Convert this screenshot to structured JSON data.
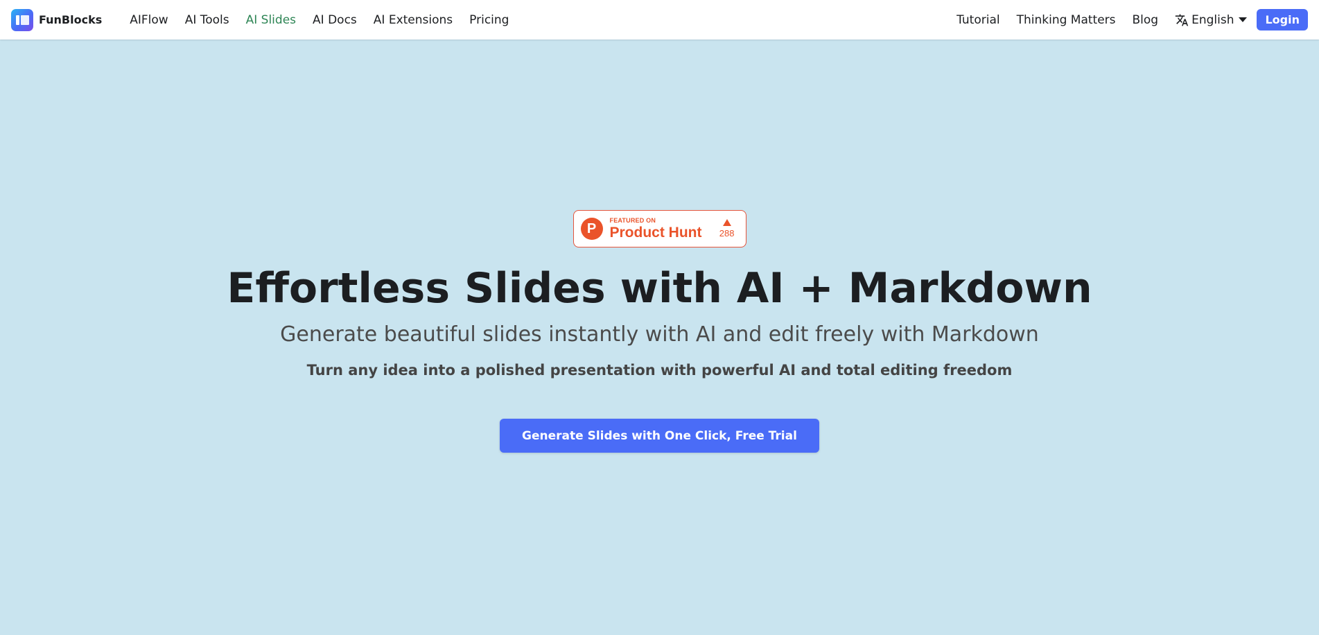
{
  "header": {
    "brand": "FunBlocks",
    "nav": [
      {
        "label": "AIFlow",
        "active": false
      },
      {
        "label": "AI Tools",
        "active": false
      },
      {
        "label": "AI Slides",
        "active": true
      },
      {
        "label": "AI Docs",
        "active": false
      },
      {
        "label": "AI Extensions",
        "active": false
      },
      {
        "label": "Pricing",
        "active": false
      }
    ],
    "right": {
      "tutorial": "Tutorial",
      "thinking": "Thinking Matters",
      "blog": "Blog",
      "language": "English",
      "login": "Login"
    }
  },
  "badge": {
    "featured": "FEATURED ON",
    "name": "Product Hunt",
    "votes": "288",
    "logo_letter": "P"
  },
  "hero": {
    "title": "Effortless Slides with AI + Markdown",
    "subtitle": "Generate beautiful slides instantly with AI and edit freely with Markdown",
    "description": "Turn any idea into a polished presentation with powerful AI and total editing freedom",
    "cta": "Generate Slides with One Click, Free Trial"
  },
  "colors": {
    "background": "#c9e4ef",
    "accent": "#4a6cf7",
    "active_link": "#2e8555",
    "product_hunt": "#ea532a"
  }
}
